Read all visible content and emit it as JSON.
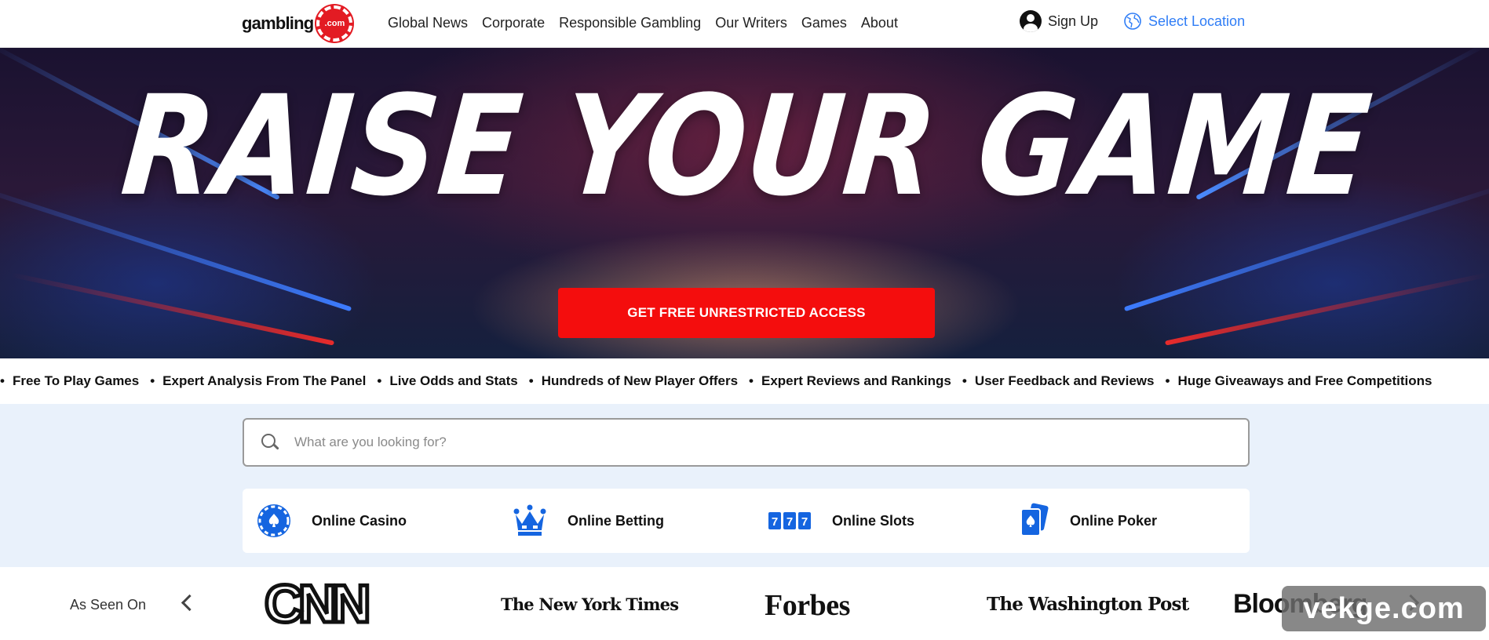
{
  "header": {
    "logo_text": "gambling",
    "logo_badge": ".com",
    "nav": [
      "Global News",
      "Corporate",
      "Responsible Gambling",
      "Our Writers",
      "Games",
      "About"
    ],
    "sign_up": "Sign Up",
    "select_location": "Select Location"
  },
  "hero": {
    "title": "RAISE YOUR GAME",
    "cta": "GET FREE UNRESTRICTED ACCESS"
  },
  "ticker": [
    "Free To Play Games",
    "Expert Analysis From The Panel",
    "Live Odds and Stats",
    "Hundreds of New Player Offers",
    "Expert Reviews and Rankings",
    "User Feedback and Reviews",
    "Huge Giveaways and Free Competitions"
  ],
  "search": {
    "placeholder": "What are you looking for?",
    "value": ""
  },
  "categories": [
    {
      "label": "Online Casino",
      "icon": "casino-chip-icon"
    },
    {
      "label": "Online Betting",
      "icon": "crown-icon"
    },
    {
      "label": "Online Slots",
      "icon": "slots-777-icon"
    },
    {
      "label": "Online Poker",
      "icon": "poker-cards-icon"
    }
  ],
  "as_seen_on": {
    "label": "As Seen On",
    "brands": [
      "CNN",
      "The New York Times",
      "Forbes",
      "The Washington Post",
      "Bloomberg"
    ]
  },
  "watermark": "vekge.com",
  "colors": {
    "accent_red": "#f40d0d",
    "link_blue": "#2f7df6",
    "icon_blue": "#1565e0",
    "band_bg": "#e9f1fb"
  }
}
